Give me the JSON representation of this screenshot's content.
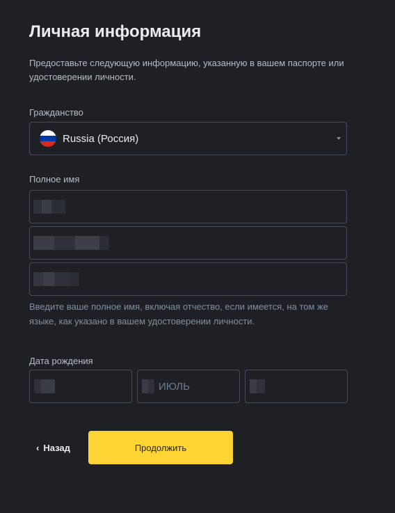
{
  "title": "Личная информация",
  "description": "Предоставьте следующую информацию, указанную в вашем паспорте или удостоверении личности.",
  "citizenship": {
    "label": "Гражданство",
    "value": "Russia (Россия)",
    "flag_colors": [
      "#ffffff",
      "#0039a6",
      "#d52b1e"
    ]
  },
  "full_name": {
    "label": "Полное имя",
    "fields": [
      "",
      "",
      ""
    ],
    "hint": "Введите ваше полное имя, включая отчество, если имеется, на том же языке, как указано в вашем удостоверении личности."
  },
  "birth_date": {
    "label": "Дата рождения",
    "day": "",
    "month": "ИЮЛЬ",
    "year": ""
  },
  "actions": {
    "back_label": "Назад",
    "continue_label": "Продолжить"
  }
}
